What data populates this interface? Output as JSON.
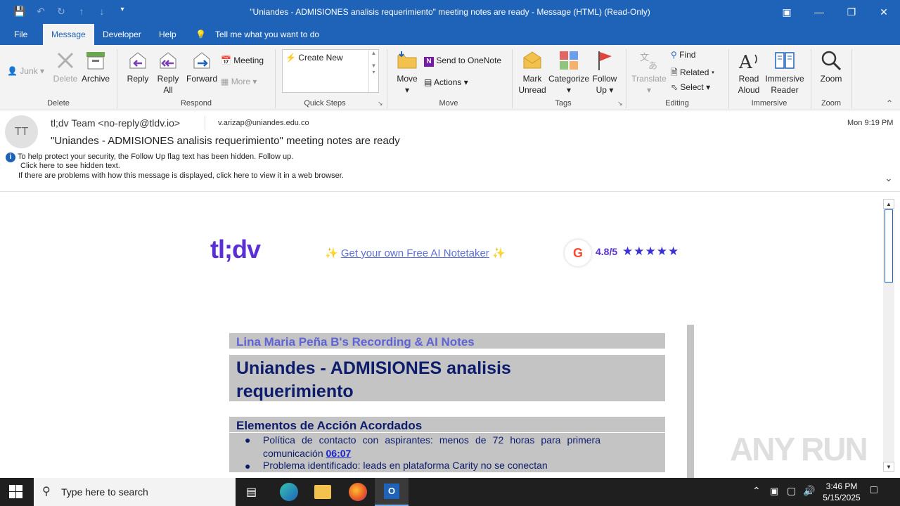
{
  "window": {
    "title": "\"Uniandes - ADMISIONES analisis requerimiento\" meeting notes are ready  -  Message (HTML) (Read-Only)"
  },
  "menu": {
    "tabs": [
      "File",
      "Message",
      "Developer",
      "Help"
    ],
    "tell_me": "Tell me what you want to do"
  },
  "ribbon": {
    "delete_group": {
      "junk": "Junk",
      "delete": "Delete",
      "archive": "Archive",
      "label": "Delete"
    },
    "respond_group": {
      "reply": "Reply",
      "reply_all_1": "Reply",
      "reply_all_2": "All",
      "forward": "Forward",
      "meeting": "Meeting",
      "more": "More",
      "label": "Respond"
    },
    "quick_steps": {
      "create_new": "Create New",
      "label": "Quick Steps"
    },
    "move_group": {
      "move": "Move",
      "onenote": "Send to OneNote",
      "actions": "Actions",
      "label": "Move"
    },
    "tags_group": {
      "mark_1": "Mark",
      "mark_2": "Unread",
      "categorize": "Categorize",
      "follow_1": "Follow",
      "follow_2": "Up",
      "label": "Tags"
    },
    "editing_group": {
      "translate": "Translate",
      "find": "Find",
      "related": "Related",
      "select": "Select",
      "label": "Editing"
    },
    "immersive_group": {
      "read_1": "Read",
      "read_2": "Aloud",
      "imm_1": "Immersive",
      "imm_2": "Reader",
      "label": "Immersive"
    },
    "zoom_group": {
      "zoom": "Zoom",
      "label": "Zoom"
    }
  },
  "message": {
    "avatar": "TT",
    "from": "tl;dv Team <no-reply@tldv.io>",
    "to": "v.arizap@uniandes.edu.co",
    "time": "Mon 9:19 PM",
    "subject": "\"Uniandes - ADMISIONES analisis requerimiento\" meeting notes are ready",
    "info_1": "To help protect your security, the Follow Up flag text has been hidden. Follow up.",
    "info_2": "Click here to see hidden text.",
    "info_3": "If there are problems with how this message is displayed, click here to view it in a web browser."
  },
  "body": {
    "logo": "tl;dv",
    "promo": "Get your own Free AI Notetaker",
    "rating": "4.8/5",
    "recording_title": "Lina Maria Peña B's Recording & AI Notes",
    "meeting_title_1": "Uniandes - ADMISIONES analisis",
    "meeting_title_2": "requerimiento",
    "section": "Elementos de Acción Acordados",
    "item1_text": "Política de contacto con aspirantes: menos de 72 horas para primera comunicación",
    "item1_link": "06:07",
    "item2_text": "Problema identificado: leads en plataforma Carity no se conectan"
  },
  "taskbar": {
    "search": "Type here to search",
    "time": "3:46 PM",
    "date": "5/15/2025"
  },
  "watermark": "ANY RUN",
  "colors": {
    "accent": "#1e63b7",
    "tldv_purple": "#5b2fd6",
    "card_gray": "#c4c4c4",
    "title_navy": "#0d1c6b"
  }
}
